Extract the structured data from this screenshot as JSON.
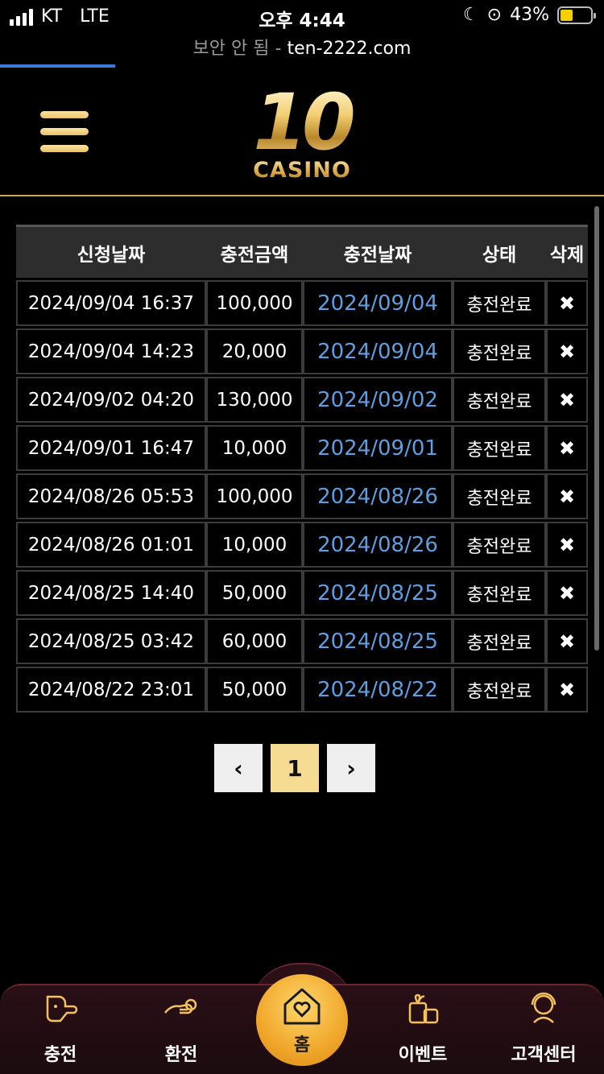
{
  "status_bar": {
    "carrier": "KT",
    "network": "LTE",
    "time": "오후 4:44",
    "battery": "43%",
    "battery_level": 0.43
  },
  "address_bar": {
    "insecure_label": "보안 안 됨",
    "separator": "-",
    "domain": "ten-2222.com",
    "load_progress": 0.19
  },
  "header": {
    "logo_number": "10",
    "logo_text": "CASINO"
  },
  "table": {
    "columns": [
      "신청날짜",
      "충전금액",
      "충전날짜",
      "상태",
      "삭제"
    ],
    "rows": [
      {
        "requested": "2024/09/04 16:37",
        "amount": "100,000",
        "charged": "2024/09/04",
        "status": "충전완료",
        "delete": "✖"
      },
      {
        "requested": "2024/09/04 14:23",
        "amount": "20,000",
        "charged": "2024/09/04",
        "status": "충전완료",
        "delete": "✖"
      },
      {
        "requested": "2024/09/02 04:20",
        "amount": "130,000",
        "charged": "2024/09/02",
        "status": "충전완료",
        "delete": "✖"
      },
      {
        "requested": "2024/09/01 16:47",
        "amount": "10,000",
        "charged": "2024/09/01",
        "status": "충전완료",
        "delete": "✖"
      },
      {
        "requested": "2024/08/26 05:53",
        "amount": "100,000",
        "charged": "2024/08/26",
        "status": "충전완료",
        "delete": "✖"
      },
      {
        "requested": "2024/08/26 01:01",
        "amount": "10,000",
        "charged": "2024/08/26",
        "status": "충전완료",
        "delete": "✖"
      },
      {
        "requested": "2024/08/25 14:40",
        "amount": "50,000",
        "charged": "2024/08/25",
        "status": "충전완료",
        "delete": "✖"
      },
      {
        "requested": "2024/08/25 03:42",
        "amount": "60,000",
        "charged": "2024/08/25",
        "status": "충전완료",
        "delete": "✖"
      },
      {
        "requested": "2024/08/22 23:01",
        "amount": "50,000",
        "charged": "2024/08/22",
        "status": "충전완료",
        "delete": "✖"
      }
    ]
  },
  "pagination": {
    "prev": "‹",
    "current": "1",
    "next": "›"
  },
  "bottom_nav": {
    "items": [
      {
        "label": "충전",
        "icon": "deposit-icon"
      },
      {
        "label": "환전",
        "icon": "withdraw-icon"
      },
      {
        "label": "홈",
        "icon": "home-heart-icon"
      },
      {
        "label": "이벤트",
        "icon": "gift-icon"
      },
      {
        "label": "고객센터",
        "icon": "support-icon"
      }
    ]
  },
  "colors": {
    "accent_gold": "#f6dc92",
    "link_blue": "#5f9ee0",
    "progress_blue": "#3f7bd6",
    "nav_bg": "#2a0f16"
  }
}
